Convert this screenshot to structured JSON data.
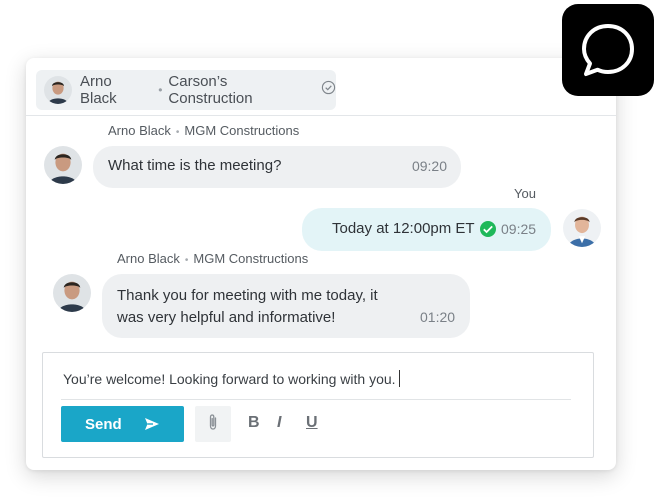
{
  "header": {
    "contact_name": "Arno Black",
    "company": "Carson’s Construction"
  },
  "messages": [
    {
      "sender": "Arno Black",
      "company": "MGM Constructions",
      "text": "What time is the meeting?",
      "time": "09:20"
    },
    {
      "sender": "You",
      "text": "Today at 12:00pm ET",
      "time": "09:25"
    },
    {
      "sender": "Arno Black",
      "company": "MGM Constructions",
      "text_line1": "Thank you for meeting with me today, it",
      "text_line2": "was very helpful and informative!",
      "time": "01:20"
    }
  ],
  "composer": {
    "value": "You’re welcome! Looking forward to working with you.",
    "send_label": "Send",
    "bold_label": "B",
    "italic_label": "I",
    "underline_label": "U"
  },
  "colors": {
    "accent": "#1aa6c8",
    "incoming_bubble": "#eef0f2",
    "outgoing_bubble": "#e3f4f7",
    "read_check": "#1fb85a"
  }
}
